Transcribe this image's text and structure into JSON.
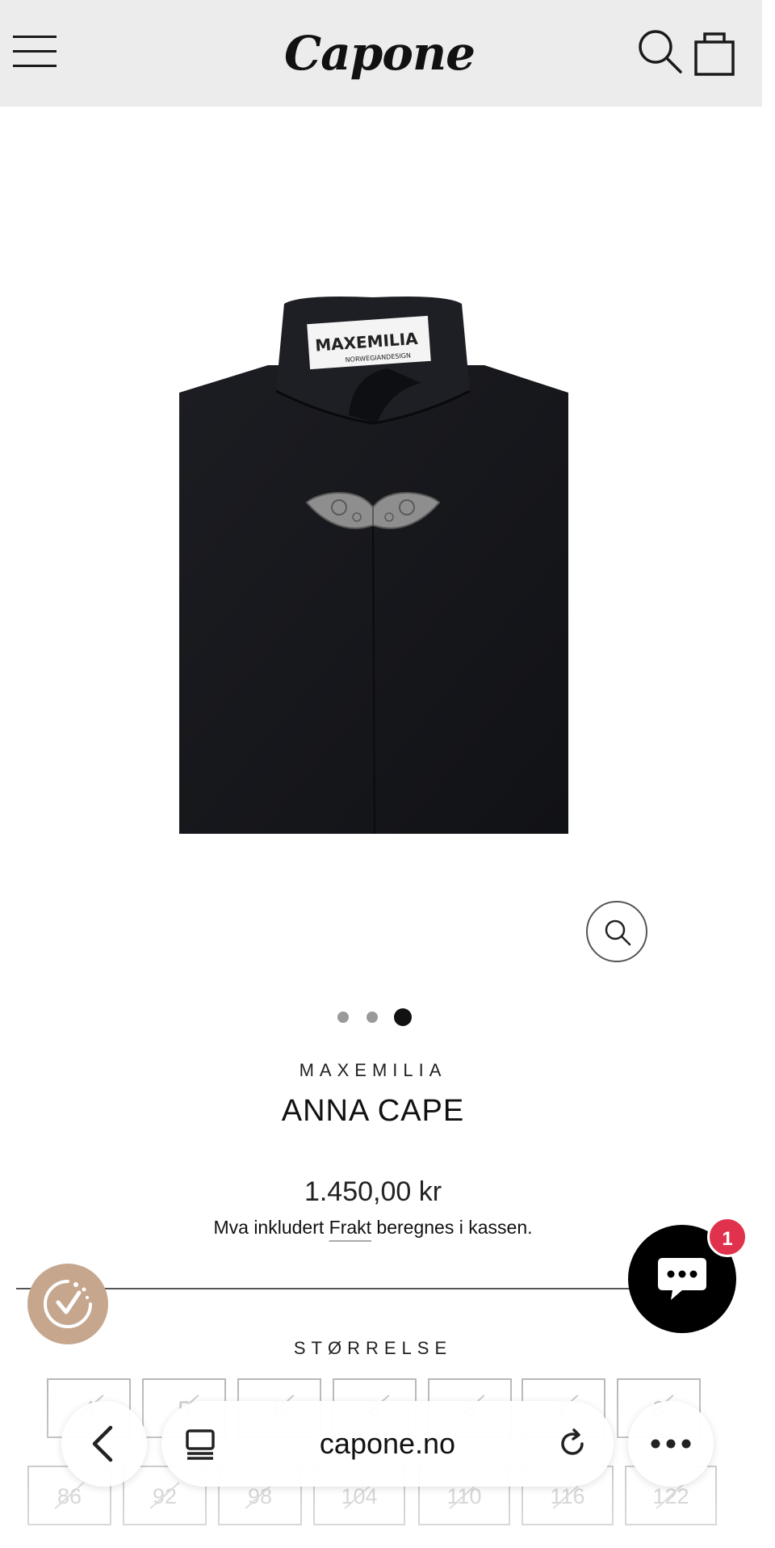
{
  "header": {
    "logo_text": "Capone",
    "menu_icon": "hamburger-menu-icon",
    "search_icon": "search-icon",
    "cart_icon": "shopping-bag-icon"
  },
  "gallery": {
    "image_label": "MAXEMILIA",
    "image_sublabel": "NORWEGIANDESIGN",
    "dot_count": 3,
    "active_dot": 3,
    "zoom_icon": "zoom-icon"
  },
  "product": {
    "vendor": "MAXEMILIA",
    "title": "ANNA CAPE",
    "price": "1.450,00 kr",
    "tax_prefix": "Mva inkludert ",
    "shipping_link": "Frakt",
    "tax_suffix": " beregnes i kassen."
  },
  "sizes": {
    "label": "STØRRELSE",
    "row1": [
      "4",
      "5",
      "5",
      "6",
      "6",
      "7",
      "8"
    ],
    "row2": [
      "86",
      "92",
      "98",
      "104",
      "110",
      "116",
      "122"
    ]
  },
  "chat": {
    "badge_count": "1",
    "icon": "chat-bubble-icon"
  },
  "rewards": {
    "icon": "rewards-badge-icon"
  },
  "browser": {
    "url": "capone.no",
    "back_icon": "back-chevron-icon",
    "tabs_icon": "tabs-icon",
    "reload_icon": "reload-icon",
    "more_icon": "more-dots-icon"
  },
  "colors": {
    "header_bg": "#ececec",
    "chat_badge": "#e0324d",
    "rewards_bg": "#c6a68d",
    "product_black": "#17181c"
  }
}
